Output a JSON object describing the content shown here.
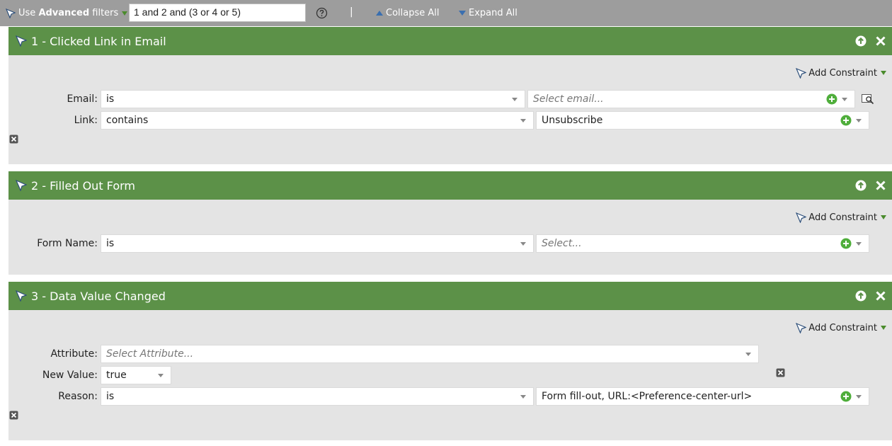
{
  "toolbar": {
    "use_label": "Use",
    "advanced_label": "Advanced",
    "filters_label": "filters",
    "filter_logic": "1 and 2 and (3 or 4 or 5)",
    "separator": "|",
    "collapse_all": "Collapse All",
    "expand_all": "Expand All"
  },
  "panels": [
    {
      "title": "1 - Clicked Link in Email",
      "add_constraint": "Add Constraint",
      "rows": [
        {
          "label": "Email:",
          "operator": "is",
          "value_placeholder": "Select email..."
        },
        {
          "label": "Link:",
          "operator": "contains",
          "value": "Unsubscribe"
        }
      ]
    },
    {
      "title": "2 - Filled Out Form",
      "add_constraint": "Add Constraint",
      "rows": [
        {
          "label": "Form Name:",
          "operator": "is",
          "value_placeholder": "Select..."
        }
      ]
    },
    {
      "title": "3 - Data Value Changed",
      "add_constraint": "Add Constraint",
      "rows": [
        {
          "label": "Attribute:",
          "value_placeholder": "Select Attribute..."
        },
        {
          "label": "New Value:",
          "value": "true"
        },
        {
          "label": "Reason:",
          "operator": "is",
          "value": "Form fill-out, URL:<Preference-center-url>"
        }
      ]
    }
  ],
  "colors": {
    "toolbar": "#9d9d9d",
    "panel_header": "#5c9148",
    "panel_body": "#e4e4e4",
    "plus_green": "#4fae3b"
  }
}
